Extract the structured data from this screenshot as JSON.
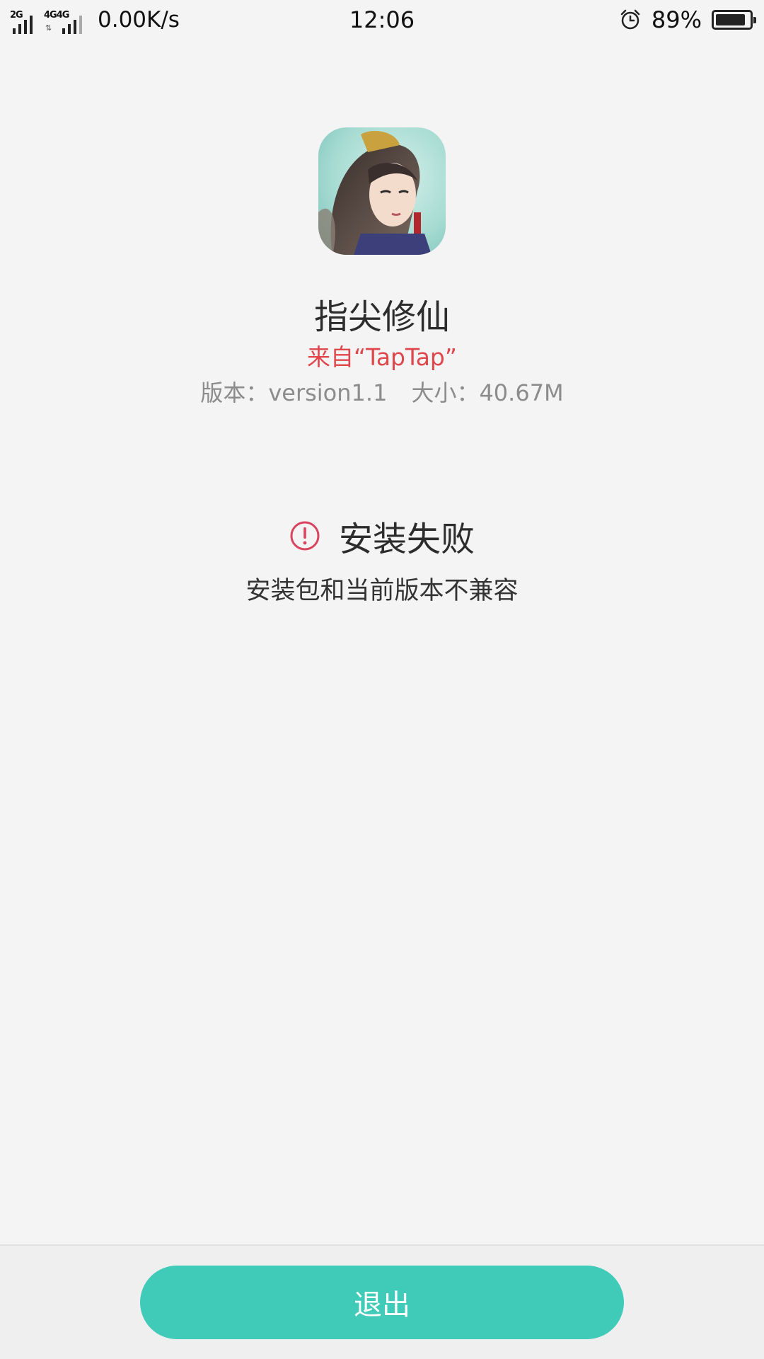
{
  "status_bar": {
    "sim1_network": "2G",
    "sim2_network": "4G",
    "sim2_network_b": "4G",
    "speed": "0.00K/s",
    "time": "12:06",
    "battery_percent": "89%",
    "battery_level": 0.89,
    "icons": [
      "signal-icon",
      "data-arrows-icon",
      "alarm-icon",
      "battery-icon"
    ]
  },
  "app": {
    "name": "指尖修仙",
    "source": "来自“TapTap”",
    "version": "版本：version1.1",
    "size": "大小：40.67M",
    "icon": "app-icon"
  },
  "result": {
    "title": "安装失败",
    "message": "安装包和当前版本不兼容",
    "icon": "error-icon",
    "icon_color": "#d9455f"
  },
  "actions": {
    "exit_label": "退出",
    "exit_color": "#40cab8"
  }
}
